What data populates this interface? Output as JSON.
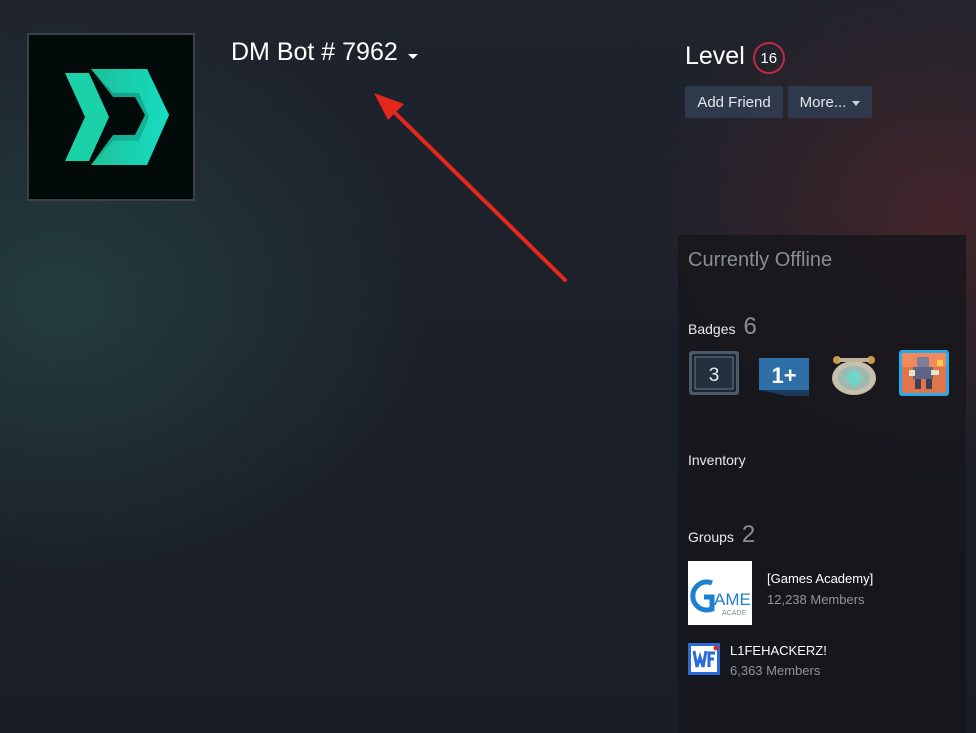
{
  "profile": {
    "name": "DM Bot # 7962",
    "avatar_icon": "dmarket-logo-icon",
    "level_label": "Level",
    "level_value": "16"
  },
  "actions": {
    "add_friend": "Add Friend",
    "more": "More..."
  },
  "sidebar": {
    "status": "Currently Offline",
    "badges_label": "Badges",
    "badges_count": "6",
    "badges": [
      {
        "icon": "badge-years-3-icon",
        "text": "3"
      },
      {
        "icon": "badge-1plus-icon",
        "text": "1+"
      },
      {
        "icon": "badge-crest-icon",
        "text": ""
      },
      {
        "icon": "badge-pixel-character-icon",
        "text": ""
      }
    ],
    "inventory_label": "Inventory",
    "groups_label": "Groups",
    "groups_count": "2",
    "groups": [
      {
        "name": "[Games Academy]",
        "members": "12,238 Members",
        "avatar": "games-academy-logo"
      },
      {
        "name": "L1FEHACKERZ!",
        "members": "6,363 Members",
        "avatar": "lifehackerz-logo"
      }
    ]
  },
  "colors": {
    "accent_level": "#c02942",
    "button_bg": "#2e3a4b",
    "annotation_arrow": "#e5281c",
    "logo_teal": "#17d8b3"
  }
}
